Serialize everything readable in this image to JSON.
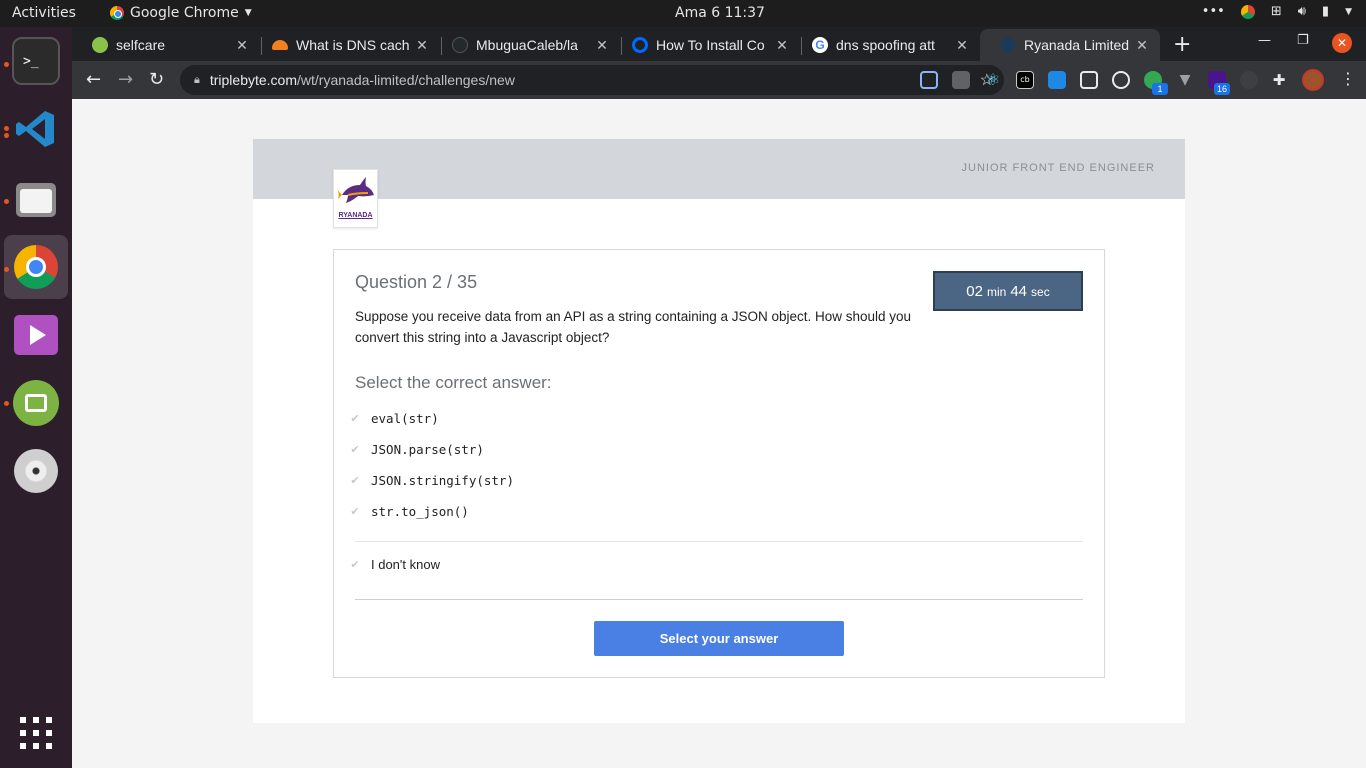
{
  "system": {
    "activities": "Activities",
    "app_name": "Google Chrome",
    "clock": "Ama 6  11:37"
  },
  "tabs": [
    {
      "title": "selfcare",
      "favicon": "selfcare-icon",
      "color": "#8bc34a"
    },
    {
      "title": "What is DNS cach",
      "favicon": "cloudflare-icon",
      "color": "#f38020"
    },
    {
      "title": "MbuguaCaleb/la",
      "favicon": "github-icon",
      "color": "#24292e"
    },
    {
      "title": "How To Install Co",
      "favicon": "digitalocean-icon",
      "color": "#0069ff"
    },
    {
      "title": "dns spoofing att",
      "favicon": "google-icon",
      "color": "#4285f4"
    },
    {
      "title": "Ryanada Limited",
      "favicon": "triplebyte-icon",
      "color": "#2b6cb0"
    }
  ],
  "omnibox": {
    "host": "triplebyte.com",
    "path": "/wt/ryanada-limited/challenges/new"
  },
  "extensions": {
    "badge_a": "1",
    "badge_b": "16"
  },
  "page": {
    "role": "JUNIOR FRONT END ENGINEER",
    "logo_text": "RYANADA",
    "question_title": "Question 2 / 35",
    "timer_minutes": "02",
    "timer_min_unit": "min",
    "timer_seconds": "44",
    "timer_sec_unit": "sec",
    "question_text": "Suppose you receive data from an API as a string containing a JSON object. How should you convert this string into a Javascript object?",
    "select_label": "Select the correct answer:",
    "options": [
      "eval(str)",
      "JSON.parse(str)",
      "JSON.stringify(str)",
      "str.to_json()"
    ],
    "dont_know": "I don't know",
    "submit_label": "Select your answer"
  }
}
